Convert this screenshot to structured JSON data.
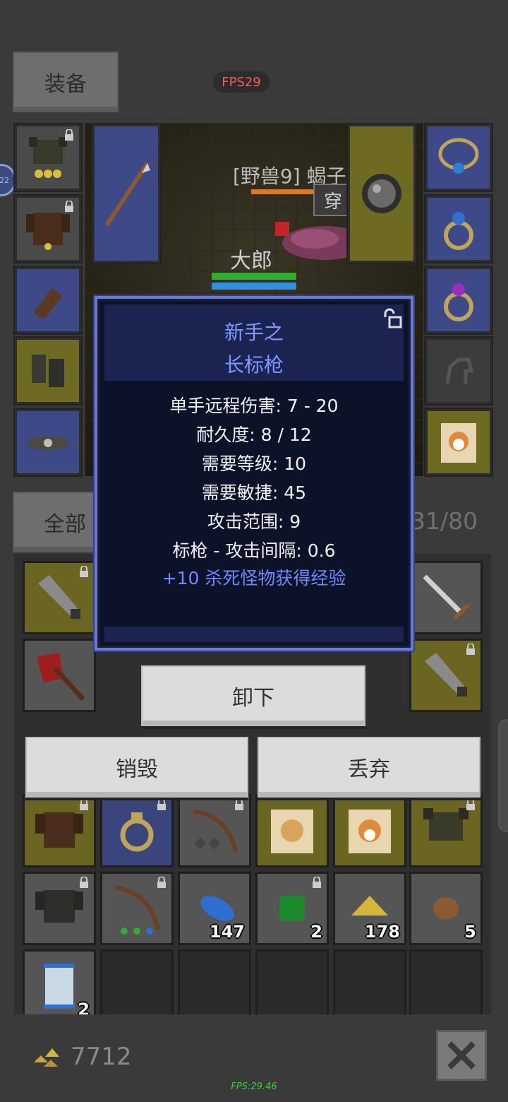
{
  "header": {
    "equip_tab": "装备",
    "fps_badge": "FPS29",
    "side_badge": "22"
  },
  "scene": {
    "monster_label": "[野兽9] 蝎子",
    "wear_label": "穿",
    "player_name": "大郎"
  },
  "tooltip": {
    "title_line1": "新手之",
    "title_line2": "长标枪",
    "stats": [
      "单手远程伤害: 7 - 20",
      "耐久度: 8 / 12",
      "需要等级: 10",
      "需要敏捷: 45",
      "攻击范围: 9",
      "标枪 - 攻击间隔: 0.6"
    ],
    "bonus": "+10 杀死怪物获得经验",
    "icon": "unlock-icon"
  },
  "actions": {
    "unequip": "卸下",
    "destroy": "销毁",
    "discard": "丢弃"
  },
  "inventory": {
    "filter_tab": "全部",
    "capacity": "31/80",
    "counts": {
      "blue_feather": "147",
      "green_gem": "2",
      "gold_ore": "178",
      "meat": "5",
      "scroll": "2"
    }
  },
  "footer": {
    "gold": "7712",
    "fps": "FPS:29.46"
  },
  "colors": {
    "tooltip_border": "#6a79d6",
    "title": "#7f97ff",
    "bonus": "#6f88ff",
    "fps_red": "#ff5757",
    "fps_green": "#35d235"
  }
}
